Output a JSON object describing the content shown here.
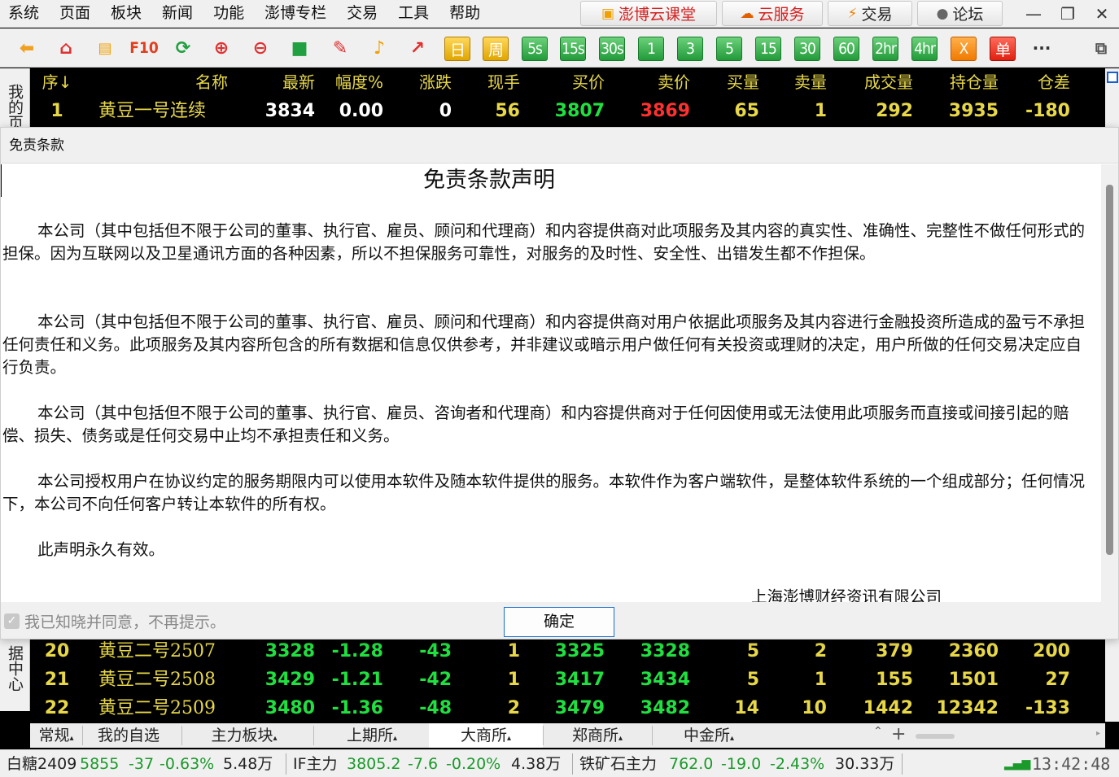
{
  "menu": [
    "系统",
    "页面",
    "板块",
    "新闻",
    "功能",
    "澎博专栏",
    "交易",
    "工具",
    "帮助"
  ],
  "top_buttons": [
    {
      "label": "澎博云课堂",
      "icon": "graduation-icon"
    },
    {
      "label": "云服务",
      "icon": "cloud-icon"
    },
    {
      "label": "交易",
      "icon": "lightning-icon"
    },
    {
      "label": "论坛",
      "icon": "chat-bubble-icon"
    }
  ],
  "toolbar": {
    "f10": "F10",
    "periods": [
      "日",
      "周",
      "5s",
      "15s",
      "30s",
      "1",
      "3",
      "5",
      "15",
      "30",
      "60",
      "2hr",
      "4hr",
      "X",
      "单"
    ],
    "more": "···"
  },
  "left_strip": {
    "top": "我的页",
    "bottom": "据中心"
  },
  "table": {
    "headers": [
      "序↓",
      "名称",
      "最新",
      "幅度%",
      "涨跌",
      "现手",
      "买价",
      "卖价",
      "买量",
      "卖量",
      "成交量",
      "持仓量",
      "仓差"
    ],
    "rows": [
      {
        "seq": "1",
        "name": "黄豆一号连续",
        "last": "3834",
        "pct": "0.00",
        "chg": "0",
        "vol_now": "56",
        "bid": "3807",
        "ask": "3869",
        "bid_vol": "65",
        "ask_vol": "1",
        "volume": "292",
        "oi": "3935",
        "oi_chg": "-180"
      },
      {
        "seq": "20",
        "name": "黄豆二号2507",
        "last": "3328",
        "pct": "-1.28",
        "chg": "-43",
        "vol_now": "1",
        "bid": "3325",
        "ask": "3328",
        "bid_vol": "5",
        "ask_vol": "2",
        "volume": "379",
        "oi": "2360",
        "oi_chg": "200"
      },
      {
        "seq": "21",
        "name": "黄豆二号2508",
        "last": "3429",
        "pct": "-1.21",
        "chg": "-42",
        "vol_now": "1",
        "bid": "3417",
        "ask": "3434",
        "bid_vol": "5",
        "ask_vol": "1",
        "volume": "155",
        "oi": "1501",
        "oi_chg": "27"
      },
      {
        "seq": "22",
        "name": "黄豆二号2509",
        "last": "3480",
        "pct": "-1.36",
        "chg": "-48",
        "vol_now": "2",
        "bid": "3479",
        "ask": "3482",
        "bid_vol": "14",
        "ask_vol": "10",
        "volume": "1442",
        "oi": "12342",
        "oi_chg": "-133"
      }
    ]
  },
  "tabs": [
    "常规",
    "我的自选",
    "主力板块",
    "上期所",
    "大商所",
    "郑商所",
    "中金所"
  ],
  "active_tab": "大商所",
  "status": [
    {
      "name": "白糖2409",
      "price": "5855",
      "chg": "-37",
      "pct": "-0.63%",
      "vol": "5.48万"
    },
    {
      "name": "IF主力",
      "price": "3805.2",
      "chg": "-7.6",
      "pct": "-0.20%",
      "vol": "4.38万"
    },
    {
      "name": "铁矿石主力",
      "price": "762.0",
      "chg": "-19.0",
      "pct": "-2.43%",
      "vol": "30.33万"
    }
  ],
  "clock": "13:42:48",
  "dialog": {
    "title": "免责条款",
    "heading": "免责条款声明",
    "paragraphs": [
      "本公司（其中包括但不限于公司的董事、执行官、雇员、顾问和代理商）和内容提供商对此项服务及其内容的真实性、准确性、完整性不做任何形式的担保。因为互联网以及卫星通讯方面的各种因素，所以不担保服务可靠性，对服务的及时性、安全性、出错发生都不作担保。",
      "本公司（其中包括但不限于公司的董事、执行官、雇员、顾问和代理商）和内容提供商对用户依据此项服务及其内容进行金融投资所造成的盈亏不承担任何责任和义务。此项服务及其内容所包含的所有数据和信息仅供参考，并非建议或暗示用户做任何有关投资或理财的决定，用户所做的任何交易决定应自行负责。",
      "本公司（其中包括但不限于公司的董事、执行官、雇员、咨询者和代理商）和内容提供商对于任何因使用或无法使用此项服务而直接或间接引起的赔偿、损失、债务或是任何交易中止均不承担责任和义务。",
      "本公司授权用户在协议约定的服务期限内可以使用本软件及随本软件提供的服务。本软件作为客户端软件，是整体软件系统的一个组成部分；任何情况下，本公司不向任何客户转让本软件的所有权。",
      "此声明永久有效。"
    ],
    "signature": "上海澎博财经资讯有限公司",
    "agree_label": "我已知晓并同意，不再提示。",
    "ok_label": "确定"
  },
  "colors": {
    "up": "#ff3030",
    "down": "#20e040",
    "neutral": "#ffffff",
    "label": "#e8d848"
  }
}
